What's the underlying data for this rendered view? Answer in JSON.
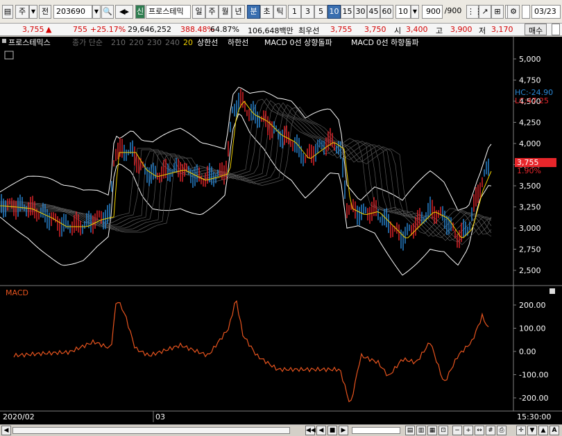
{
  "toolbar": {
    "market_label": "주",
    "prev_label": "전",
    "code": "203690",
    "new_badge": "신",
    "stock_name": "프로스테믹",
    "periods": [
      "일",
      "주",
      "월",
      "년",
      "분",
      "초",
      "틱"
    ],
    "minutes": [
      "1",
      "3",
      "5",
      "10",
      "15",
      "30",
      "45",
      "60"
    ],
    "count_value": "10",
    "range_value": "900",
    "range_total": "/900",
    "date_value": "03/23"
  },
  "quote": {
    "price": "3,755",
    "arrow": "▲",
    "change": "755",
    "rate": "+25.17%",
    "volume": "29,646,252",
    "vol_ratio": "388.48%",
    "turnover": "64.87%",
    "amount": "106,648백만",
    "best_label": "최우선",
    "best_ask": "3,755",
    "best_bid": "3,750",
    "open_label": "시",
    "open": "3,400",
    "high_label": "고",
    "high": "3,900",
    "low_label": "저",
    "low": "3,170",
    "buy_button": "매수"
  },
  "legend": {
    "name": "프로스테믹스",
    "ma_label": "종가 단순",
    "ma1": "210",
    "ma2": "220",
    "ma3": "230",
    "ma4": "240",
    "ma5": "20",
    "upper": "상한선",
    "lower": "하한선",
    "macd_up": "MACD 0선 상향돌파",
    "macd_down": "MACD 0선 하향돌파"
  },
  "price_axis": {
    "labels": [
      "5,000",
      "4,750",
      "4,500",
      "4,250",
      "4,000",
      "3,750",
      "3,500",
      "3,250",
      "3,000",
      "2,750",
      "2,500"
    ],
    "lc": "LC:47.25",
    "hc": "HC:-24.90",
    "current": "3,755",
    "current_pct": "1.90%"
  },
  "macd": {
    "title": "MACD",
    "labels": [
      "200.00",
      "100.00",
      "0.00",
      "-100.00",
      "-200.00"
    ]
  },
  "time_axis": {
    "start": "2020/02",
    "mid": "03",
    "end": "15:30:00"
  },
  "colors": {
    "up": "#e8262b",
    "down": "#2a8ad8",
    "ma": "#f2d200",
    "band": "#ffffff",
    "macd": "#e8541e"
  }
}
